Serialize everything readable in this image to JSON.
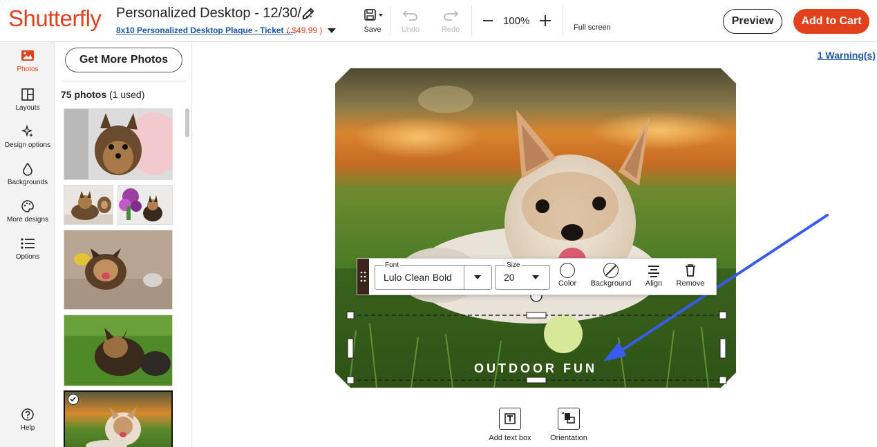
{
  "header": {
    "logo": "Shutterfly",
    "project_title": "Personalized Desktop - 12/30/...",
    "product_link": "8x10 Personalized Desktop Plaque - Ticket ...",
    "price": "$49.99",
    "price_open": "(",
    "price_close": ")",
    "save": "Save",
    "undo": "Undo",
    "redo": "Redo",
    "zoom": "100%",
    "full_screen": "Full screen",
    "preview": "Preview",
    "add_to_cart": "Add to Cart"
  },
  "rail": {
    "items": [
      {
        "label": "Photos",
        "icon": "photo-icon"
      },
      {
        "label": "Layouts",
        "icon": "layouts-icon"
      },
      {
        "label": "Design options",
        "icon": "sparkle-icon"
      },
      {
        "label": "Backgrounds",
        "icon": "drop-icon"
      },
      {
        "label": "More designs",
        "icon": "palette-icon"
      },
      {
        "label": "Options",
        "icon": "list-icon"
      }
    ],
    "help": "Help"
  },
  "panel": {
    "get_more_photos": "Get More Photos",
    "photo_count": "75 photos",
    "used_count": "(1 used)"
  },
  "canvas": {
    "warning": "1 Warning(s)",
    "plaque_text": "OUTDOOR FUN",
    "toolbar": {
      "font_label": "Font",
      "font_value": "Lulo Clean Bold",
      "size_label": "Size",
      "size_value": "20",
      "color": "Color",
      "background": "Background",
      "align": "Align",
      "remove": "Remove"
    },
    "add_text_box": "Add text box",
    "orientation": "Orientation"
  },
  "colors": {
    "brand": "#e2411e",
    "link": "#1a56a6",
    "annotation_arrow": "#3a5bf0"
  }
}
